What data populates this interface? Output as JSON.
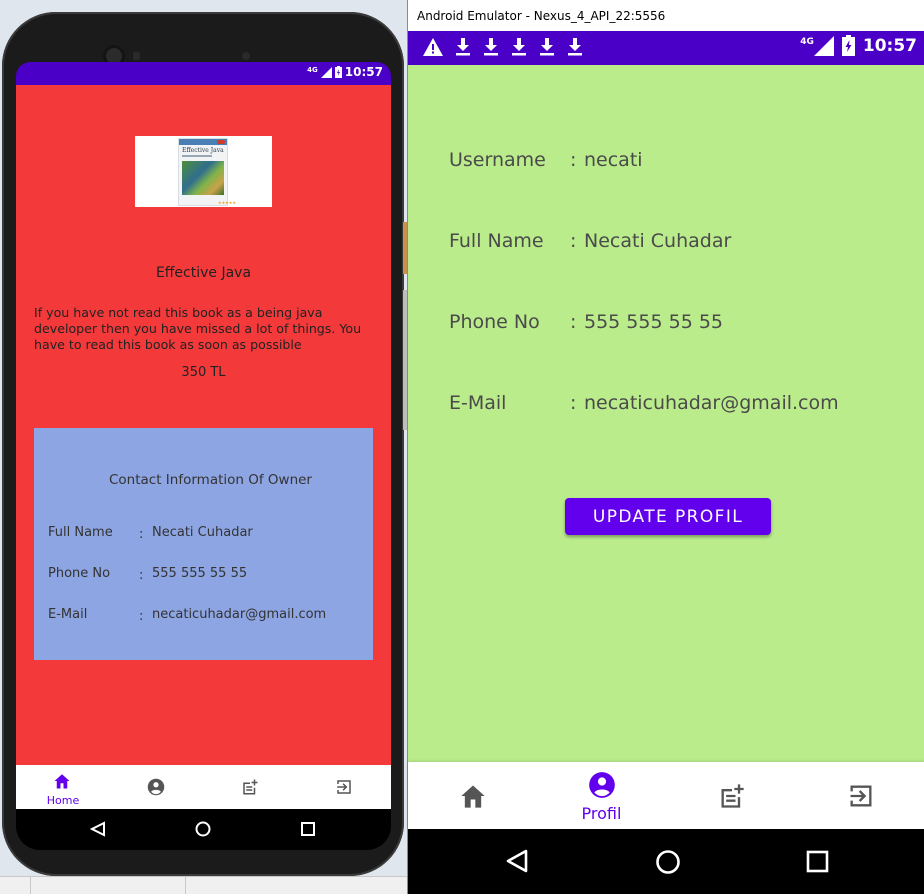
{
  "left_phone": {
    "status_time": "10:57",
    "network": "4G",
    "book": {
      "cover_title": "Effective Java",
      "title": "Effective Java",
      "description": "If you have not read this book as a being java developer then you have missed a lot of things. You have to read this book as soon as possible",
      "price": "350 TL"
    },
    "contact": {
      "heading": "Contact Information Of Owner",
      "separator": ":",
      "rows": [
        {
          "label": "Full Name",
          "value": "Necati Cuhadar"
        },
        {
          "label": "Phone No",
          "value": "555 555 55 55"
        },
        {
          "label": "E-Mail",
          "value": "necaticuhadar@gmail.com"
        }
      ]
    },
    "nav": {
      "home_label": "Home"
    },
    "colors": {
      "content_bg": "#f4393b",
      "contact_bg": "#8ea5e3",
      "accent": "#6200ee",
      "status_bar": "#4b00c8"
    }
  },
  "emulator": {
    "window_title": "Android Emulator - Nexus_4_API_22:5556",
    "status_time": "10:57",
    "network": "4G",
    "separator": ":",
    "profile": [
      {
        "label": "Username",
        "value": "necati"
      },
      {
        "label": "Full Name",
        "value": "Necati Cuhadar"
      },
      {
        "label": "Phone No",
        "value": "555 555 55 55"
      },
      {
        "label": "E-Mail",
        "value": "necaticuhadar@gmail.com"
      }
    ],
    "update_button": "UPDATE PROFIL",
    "nav": {
      "profile_label": "Profil"
    },
    "colors": {
      "content_bg": "#bbec8c",
      "accent": "#6200ee",
      "status_bar": "#4b00c8"
    }
  },
  "icons": [
    "home-icon",
    "account-circle-icon",
    "post-add-icon",
    "exit-to-app-icon",
    "warning-icon",
    "download-icon",
    "signal-icon",
    "battery-icon",
    "back-icon",
    "home-circle-icon",
    "recents-icon"
  ]
}
